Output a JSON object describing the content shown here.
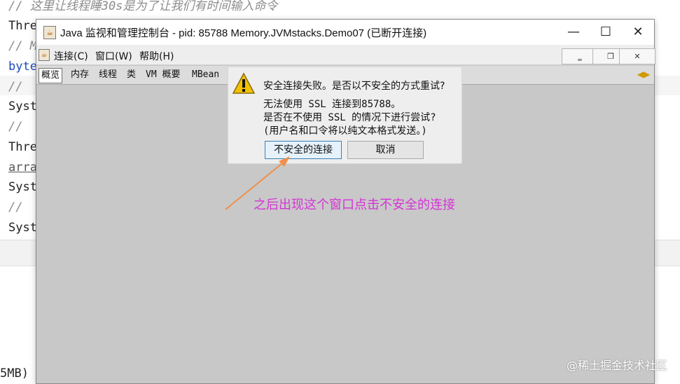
{
  "editor": {
    "lines": [
      {
        "text": "// 这里让线程睡30s是为了让我们有时间输入命令",
        "style": "comment"
      },
      {
        "text": "Thre",
        "style": "normal"
      },
      {
        "text": "// M",
        "style": "comment"
      },
      {
        "text": "byte",
        "style": "keyword"
      },
      {
        "text": "// ",
        "style": "comment"
      },
      {
        "text": "Syst",
        "style": "normal"
      },
      {
        "text": "// ",
        "style": "comment"
      },
      {
        "text": "Thre",
        "style": "normal"
      },
      {
        "text": "arra",
        "style": "underline"
      },
      {
        "text": "Syst",
        "style": "normal"
      },
      {
        "text": "// ",
        "style": "comment"
      },
      {
        "text": "Syst",
        "style": "normal"
      }
    ],
    "console_text": "5MB)"
  },
  "window": {
    "title": "Java 监视和管理控制台 - pid: 85788 Memory.JVMstacks.Demo07 (已断开连接)",
    "controls": {
      "minimize": "—",
      "maximize": "☐",
      "close": "✕"
    },
    "menu": [
      {
        "label": "连接(C)"
      },
      {
        "label": "窗口(W)"
      },
      {
        "label": "帮助(H)"
      }
    ],
    "inner_controls": {
      "minimize": "‗",
      "restore": "❐",
      "close": "✕"
    },
    "tabs": [
      {
        "label": "概览",
        "selected": true
      },
      {
        "label": "内存",
        "selected": false
      },
      {
        "label": "线程",
        "selected": false
      },
      {
        "label": "类",
        "selected": false
      },
      {
        "label": "VM 概要",
        "selected": false
      },
      {
        "label": "MBean",
        "selected": false
      }
    ]
  },
  "dialog": {
    "title": "安全连接失败。是否以不安全的方式重试?",
    "message_lines": [
      "无法使用 SSL 连接到85788。",
      "是否在不使用 SSL 的情况下进行尝试?",
      "(用户名和口令将以纯文本格式发送。)"
    ],
    "buttons": {
      "insecure": "不安全的连接",
      "cancel": "取消"
    }
  },
  "annotation": {
    "text": "之后出现这个窗口点击不安全的连接",
    "color": "#d633d6",
    "arrow_color": "#f0904a"
  },
  "watermark": "@稀土掘金技术社区"
}
